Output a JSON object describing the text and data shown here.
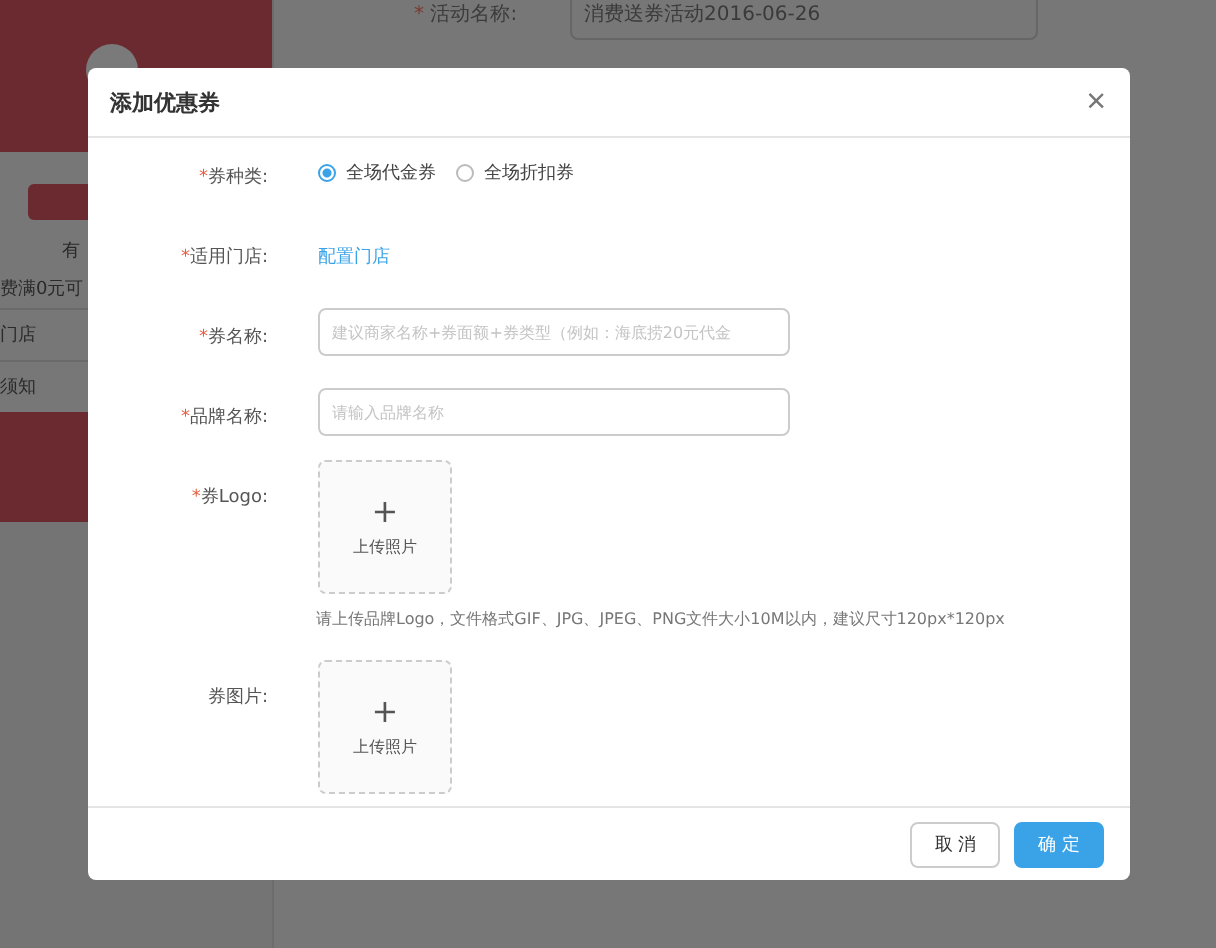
{
  "background": {
    "activity_mark": "*",
    "activity_label": "活动名称:",
    "activity_value": "消费送券活动2016-06-26",
    "side_texts": [
      "有",
      "费满0元可",
      "门店",
      "须知"
    ]
  },
  "dialog": {
    "title": "添加优惠券",
    "close": "×",
    "fields": [
      {
        "kind": "radio",
        "label": "券种类:",
        "mark": "*",
        "options": [
          {
            "label": "全场代金券",
            "selected": true
          },
          {
            "label": "全场折扣券",
            "selected": false
          }
        ]
      },
      {
        "kind": "link",
        "label": "适用门店:",
        "mark": "*",
        "text": "配置门店"
      },
      {
        "kind": "input",
        "label": "券名称:",
        "mark": "*",
        "placeholder": "建议商家名称+券面额+券类型（例如：海底捞20元代金"
      },
      {
        "kind": "input",
        "label": "品牌名称:",
        "mark": "*",
        "placeholder": "请输入品牌名称"
      },
      {
        "kind": "upload",
        "label": "券Logo:",
        "mark": "*",
        "plus": "+",
        "text": "上传照片",
        "hint": "请上传品牌Logo，文件格式GIF、JPG、JPEG、PNG文件大小10M以内，建议尺寸120px*120px"
      },
      {
        "kind": "upload",
        "label": "券图片:",
        "plus": "+",
        "text": "上传照片"
      }
    ],
    "buttons": [
      {
        "label": "取 消",
        "kind": "default"
      },
      {
        "label": "确 定",
        "kind": "primary"
      }
    ]
  }
}
